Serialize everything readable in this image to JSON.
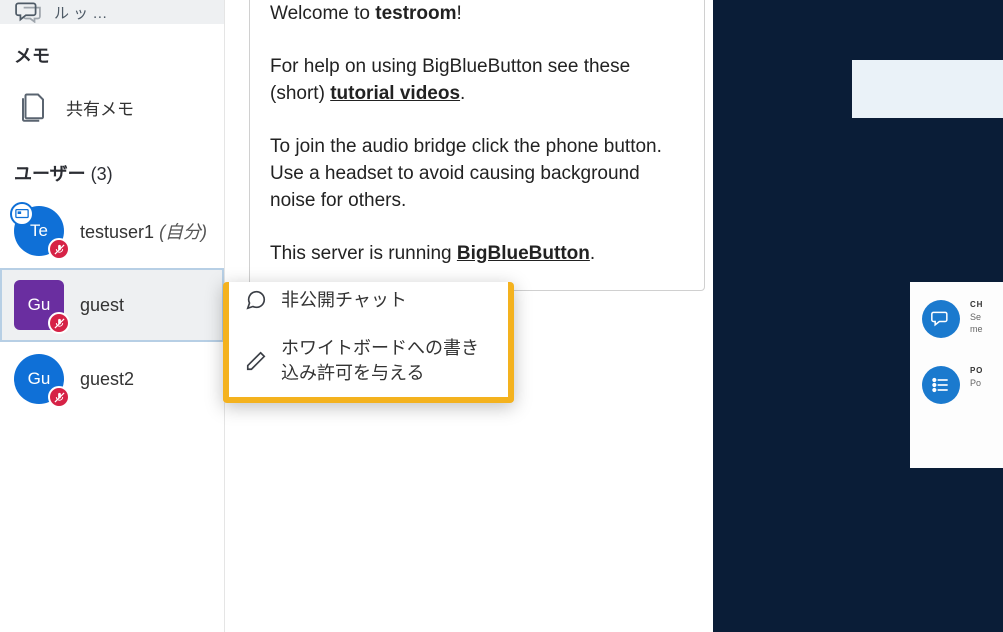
{
  "sidebar": {
    "chat_item_label": " ル   ッ  …",
    "memo_header": "メモ",
    "shared_notes_label": "共有メモ",
    "users_header": "ユーザー",
    "users_count": "(3)",
    "users": [
      {
        "initials": "Te",
        "name": "testuser1",
        "self_suffix": "(自分)",
        "color": "blue",
        "presenter": true,
        "muted": true,
        "square": false
      },
      {
        "initials": "Gu",
        "name": "guest",
        "self_suffix": "",
        "color": "purple",
        "presenter": false,
        "muted": true,
        "square": true
      },
      {
        "initials": "Gu",
        "name": "guest2",
        "self_suffix": "",
        "color": "blue",
        "presenter": false,
        "muted": true,
        "square": false
      }
    ]
  },
  "welcome": {
    "line1_pre": "Welcome to ",
    "line1_room": "testroom",
    "line1_post": "!",
    "line2_pre": "For help on using BigBlueButton see these (short) ",
    "line2_link": "tutorial videos",
    "line2_post": ".",
    "line3": "To join the audio bridge click the phone button. Use a headset to avoid causing background noise for others.",
    "line4_pre": "This server is running ",
    "line4_link": "BigBlueButton",
    "line4_post": "."
  },
  "context_menu": {
    "private_chat": "非公開チャット",
    "whiteboard_grant": "ホワイトボードへの書き込み許可を与える"
  },
  "slide": {
    "feat1_head": "CH",
    "feat1_sub1": "Se",
    "feat1_sub2": "me",
    "feat2_head": "PO",
    "feat2_sub1": "Po"
  }
}
